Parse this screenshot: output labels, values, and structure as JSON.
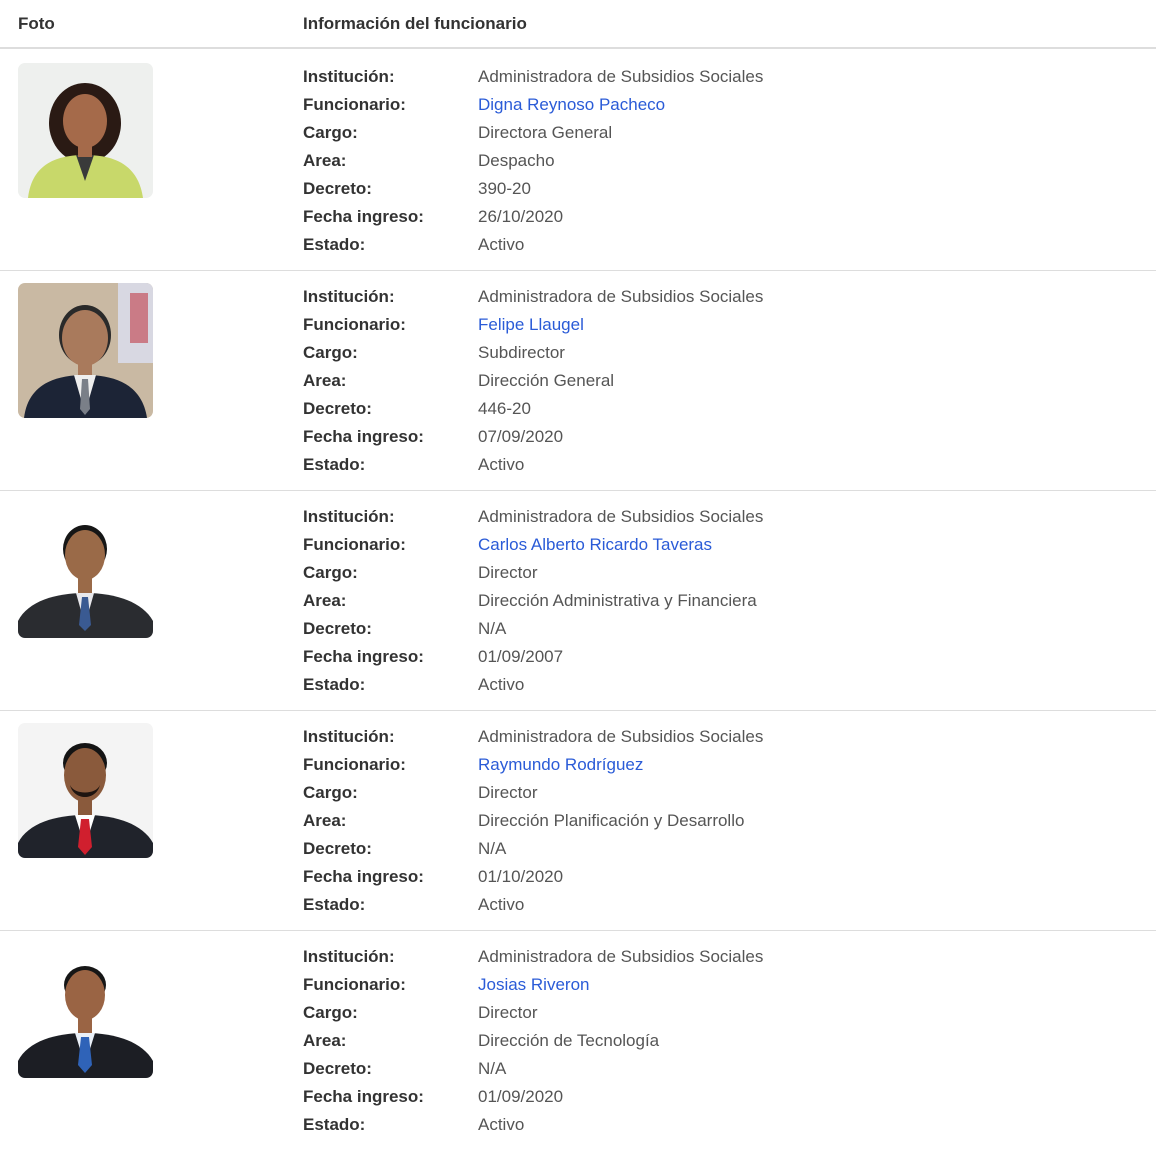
{
  "table": {
    "header": {
      "foto": "Foto",
      "info": "Información del funcionario"
    },
    "labels": {
      "institucion": "Institución:",
      "funcionario": "Funcionario:",
      "cargo": "Cargo:",
      "area": "Area:",
      "decreto": "Decreto:",
      "fecha_ingreso": "Fecha ingreso:",
      "estado": "Estado:"
    },
    "colors": {
      "link": "#2a5bd7",
      "text": "#555555",
      "label": "#333333",
      "divider": "#dddddd"
    },
    "rows": [
      {
        "institucion": "Administradora de Subsidios Sociales",
        "funcionario": "Digna Reynoso Pacheco",
        "cargo": "Directora General",
        "area": "Despacho",
        "decreto": "390-20",
        "fecha_ingreso": "26/10/2020",
        "estado": "Activo"
      },
      {
        "institucion": "Administradora de Subsidios Sociales",
        "funcionario": "Felipe Llaugel",
        "cargo": "Subdirector",
        "area": "Dirección General",
        "decreto": "446-20",
        "fecha_ingreso": "07/09/2020",
        "estado": "Activo"
      },
      {
        "institucion": "Administradora de Subsidios Sociales",
        "funcionario": "Carlos Alberto Ricardo Taveras",
        "cargo": "Director",
        "area": "Dirección Administrativa y Financiera",
        "decreto": "N/A",
        "fecha_ingreso": "01/09/2007",
        "estado": "Activo"
      },
      {
        "institucion": "Administradora de Subsidios Sociales",
        "funcionario": "Raymundo Rodríguez",
        "cargo": "Director",
        "area": "Dirección Planificación y Desarrollo",
        "decreto": "N/A",
        "fecha_ingreso": "01/10/2020",
        "estado": "Activo"
      },
      {
        "institucion": "Administradora de Subsidios Sociales",
        "funcionario": "Josias Riveron",
        "cargo": "Director",
        "area": "Dirección de Tecnología",
        "decreto": "N/A",
        "fecha_ingreso": "01/09/2020",
        "estado": "Activo"
      }
    ]
  }
}
